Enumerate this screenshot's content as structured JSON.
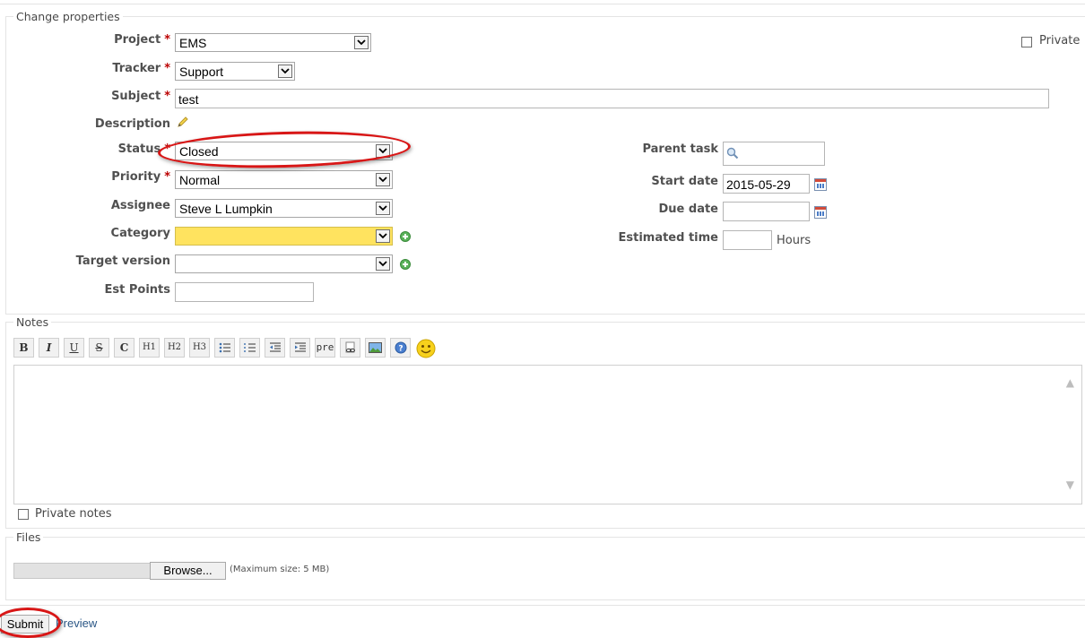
{
  "form": {
    "legend": "Change properties",
    "private_label": "Private",
    "required_mark": "*",
    "project": {
      "label": "Project",
      "value": "EMS"
    },
    "tracker": {
      "label": "Tracker",
      "value": "Support"
    },
    "subject": {
      "label": "Subject",
      "value": "test"
    },
    "description": {
      "label": "Description"
    },
    "status": {
      "label": "Status",
      "value": "Closed"
    },
    "priority": {
      "label": "Priority",
      "value": "Normal"
    },
    "assignee": {
      "label": "Assignee",
      "value": "Steve L Lumpkin"
    },
    "category": {
      "label": "Category",
      "value": ""
    },
    "target_version": {
      "label": "Target version",
      "value": ""
    },
    "est_points": {
      "label": "Est Points",
      "value": ""
    },
    "parent_task": {
      "label": "Parent task",
      "value": ""
    },
    "start_date": {
      "label": "Start date",
      "value": "2015-05-29"
    },
    "due_date": {
      "label": "Due date",
      "value": ""
    },
    "estimated_time": {
      "label": "Estimated time",
      "value": "",
      "unit": "Hours"
    }
  },
  "notes": {
    "legend": "Notes",
    "toolbar": [
      "B",
      "I",
      "U",
      "S",
      "C",
      "H1",
      "H2",
      "H3",
      "ul",
      "ol",
      "outdent",
      "indent",
      "pre",
      "link",
      "image",
      "help",
      "smiley"
    ],
    "toolbar_text": {
      "bold": "B",
      "italic": "I",
      "underline": "U",
      "strike": "S",
      "code": "C",
      "h1": "H1",
      "h2": "H2",
      "h3": "H3",
      "pre": "pre"
    },
    "private_notes_label": "Private notes"
  },
  "files": {
    "legend": "Files",
    "browse_label": "Browse...",
    "max_size": "(Maximum size: 5 MB)"
  },
  "actions": {
    "submit_label": "Submit",
    "preview_label": "Preview"
  },
  "colors": {
    "highlight_field": "#ffe35f",
    "required": "#bb0000",
    "annotation_circle": "#d81616",
    "link": "#2a5685"
  }
}
